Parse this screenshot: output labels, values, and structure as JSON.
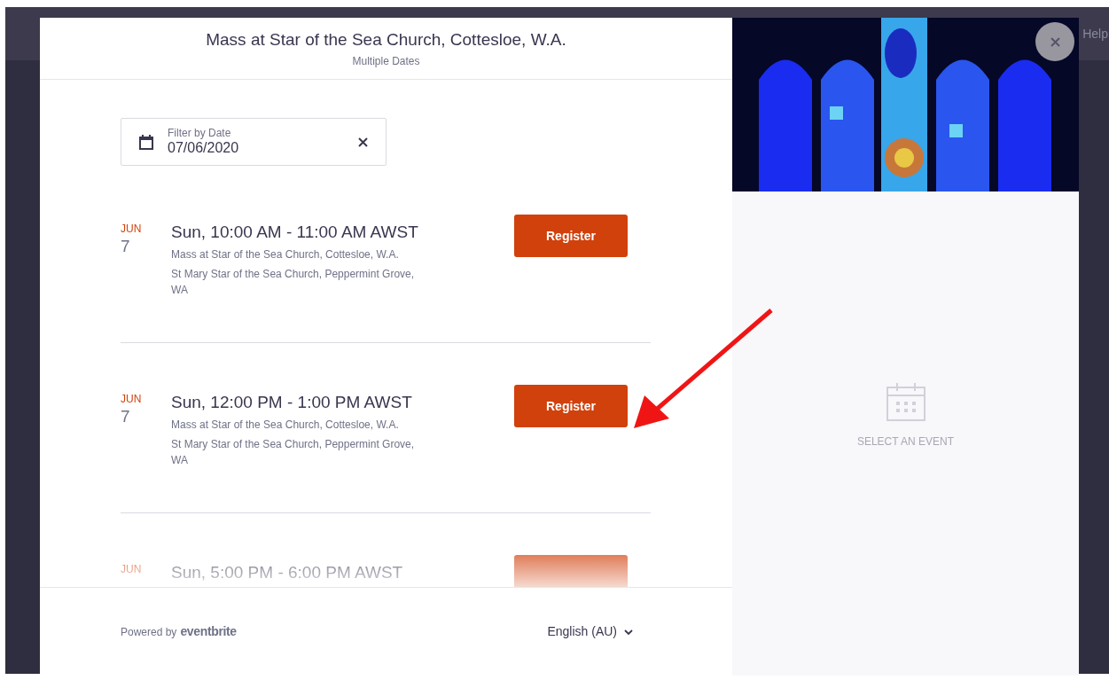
{
  "background": {
    "help_link": "Help"
  },
  "modal": {
    "title": "Mass at Star of the Sea Church, Cottesloe, W.A.",
    "subtitle": "Multiple Dates",
    "filter": {
      "label": "Filter by Date",
      "value": "07/06/2020"
    },
    "events": [
      {
        "month": "JUN",
        "day": "7",
        "time": "Sun, 10:00 AM - 11:00 AM AWST",
        "name": "Mass at Star of the Sea Church, Cottesloe, W.A.",
        "venue": "St Mary Star of the Sea Church, Peppermint Grove, WA",
        "button": "Register"
      },
      {
        "month": "JUN",
        "day": "7",
        "time": "Sun, 12:00 PM - 1:00 PM AWST",
        "name": "Mass at Star of the Sea Church, Cottesloe, W.A.",
        "venue": "St Mary Star of the Sea Church, Peppermint Grove, WA",
        "button": "Register"
      },
      {
        "month": "JUN",
        "time": "Sun, 5:00 PM - 6:00 PM AWST"
      }
    ],
    "footer": {
      "powered_by": "Powered by",
      "brand": "eventbrite",
      "language": "English (AU)"
    },
    "side_panel": {
      "empty_message": "SELECT AN EVENT"
    }
  }
}
